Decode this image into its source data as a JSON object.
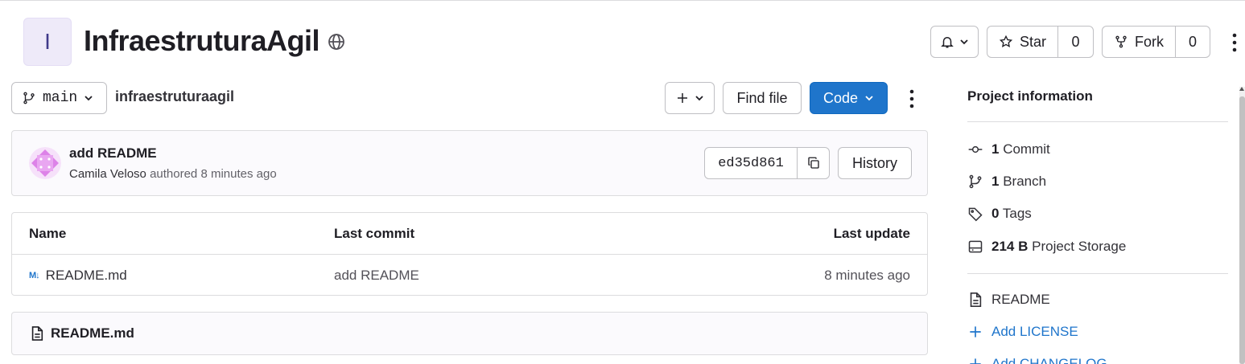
{
  "project": {
    "avatar_letter": "I",
    "title": "InfraestruturaAgil",
    "visibility_icon": "globe-icon"
  },
  "actions": {
    "notifications_icon": "bell-icon",
    "star_label": "Star",
    "star_count": "0",
    "fork_label": "Fork",
    "fork_count": "0"
  },
  "toolbar": {
    "branch": "main",
    "path": "infraestruturaagil",
    "find_file": "Find file",
    "code": "Code"
  },
  "last_commit": {
    "title": "add README",
    "author": "Camila Veloso",
    "authored_label": "authored",
    "time": "8 minutes ago",
    "sha": "ed35d861",
    "history": "History"
  },
  "file_table": {
    "headers": [
      "Name",
      "Last commit",
      "Last update"
    ],
    "rows": [
      {
        "name": "README.md",
        "commit": "add README",
        "updated": "8 minutes ago"
      }
    ]
  },
  "readme": {
    "filename": "README.md"
  },
  "sidebar": {
    "title": "Project information",
    "stats": [
      {
        "count": "1",
        "label": "Commit",
        "icon": "commit-icon"
      },
      {
        "count": "1",
        "label": "Branch",
        "icon": "branch-icon"
      },
      {
        "count": "0",
        "label": "Tags",
        "icon": "tag-icon"
      },
      {
        "count": "214 B",
        "label": "Project Storage",
        "icon": "storage-icon"
      }
    ],
    "links": [
      {
        "label": "README",
        "icon": "document-icon"
      },
      {
        "label": "Add LICENSE",
        "icon": "plus-icon"
      },
      {
        "label": "Add CHANGELOG",
        "icon": "plus-icon"
      }
    ]
  },
  "colors": {
    "primary": "#1f75cb",
    "border": "#dcdcde",
    "avatar_bg": "#eeeaf9",
    "commit_avatar": "#dd82e8"
  }
}
